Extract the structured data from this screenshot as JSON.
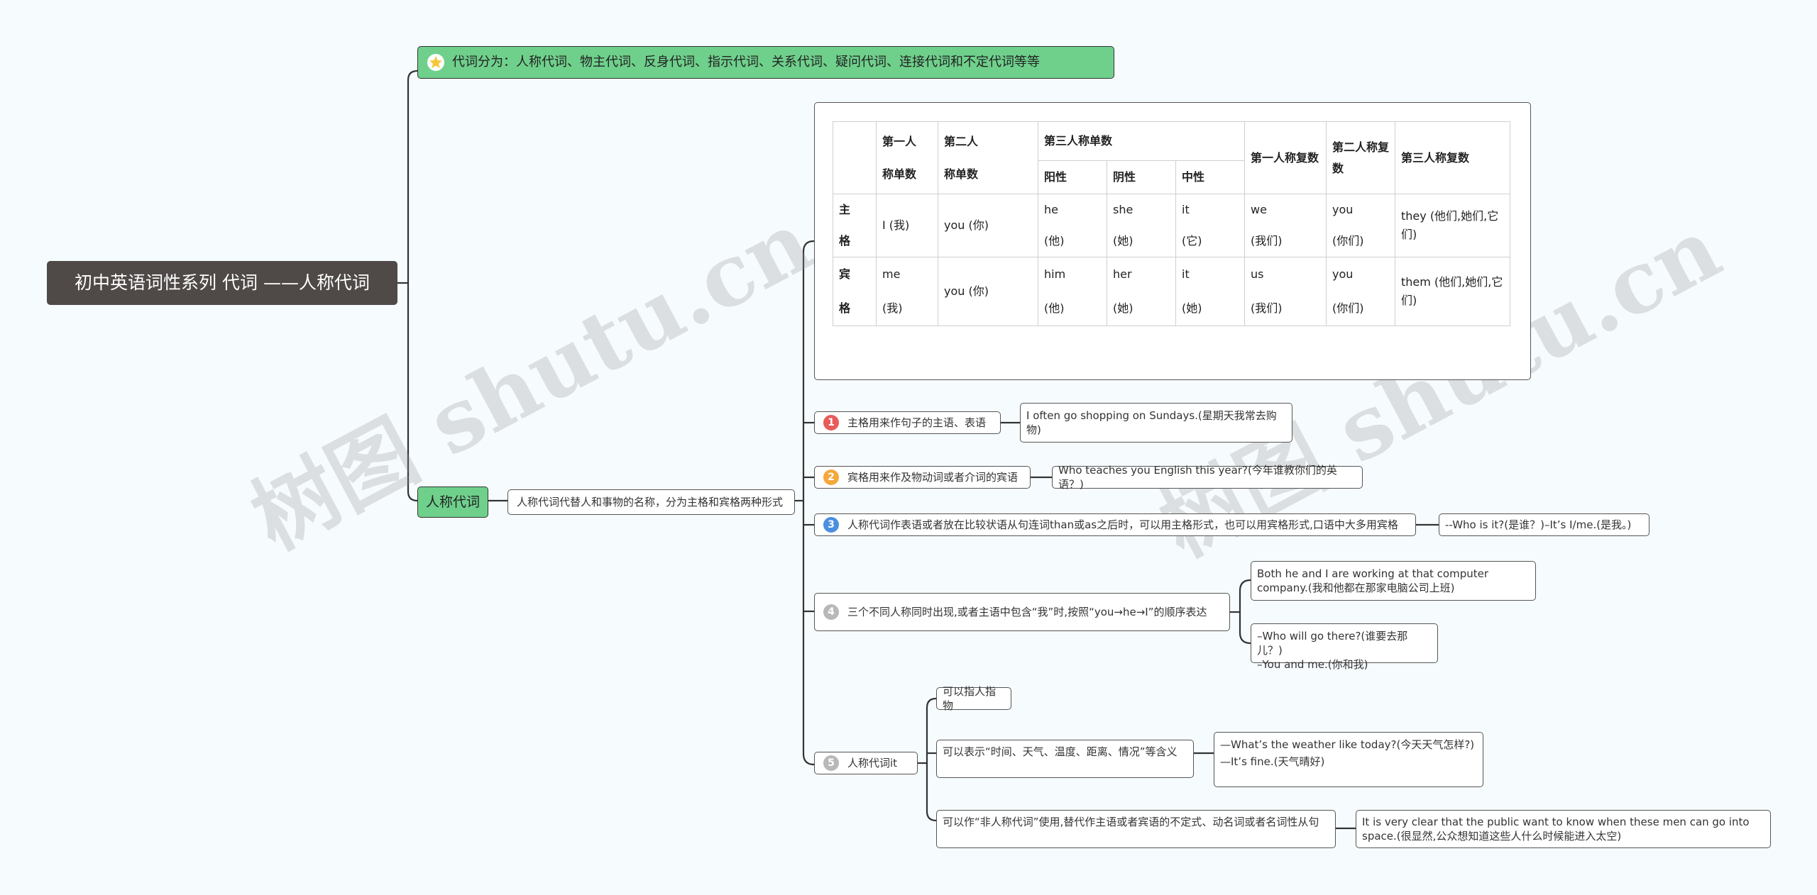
{
  "root": {
    "title": "初中英语词性系列 代词 ——人称代词"
  },
  "top_note": {
    "text": "代词分为：人称代词、物主代词、反身代词、指示代词、关系代词、疑问代词、连接代词和不定代词等等"
  },
  "branch": {
    "label": "人称代词",
    "desc": "人称代词代替人和事物的名称，分为主格和宾格两种形式"
  },
  "table": {
    "h_first_single_a": "第一人",
    "h_first_single_b": "称单数",
    "h_second_single_a": "第二人",
    "h_second_single_b": "称单数",
    "h_third_single": "第三人称单数",
    "h_masc": "阳性",
    "h_fem": "阴性",
    "h_neut": "中性",
    "h_first_plural": "第一人称复数",
    "h_second_plural": "第二人称复数",
    "h_third_plural": "第三人称复数",
    "row1_label_a": "主",
    "row1_label_b": "格",
    "row1": {
      "c1": "I (我)",
      "c2": "you (你)",
      "c3a": "he",
      "c3b": "(他)",
      "c4a": "she",
      "c4b": "(她)",
      "c5a": "it",
      "c5b": "(它)",
      "c6a": "we",
      "c6b": "(我们)",
      "c7a": "you",
      "c7b": "(你们)",
      "c8": "they (他们,她们,它们)"
    },
    "row2_label_a": "宾",
    "row2_label_b": "格",
    "row2": {
      "c1a": "me",
      "c1b": "(我)",
      "c2": "you (你)",
      "c3a": "him",
      "c3b": "(他)",
      "c4a": "her",
      "c4b": "(她)",
      "c5a": "it",
      "c5b": "(她)",
      "c6a": "us",
      "c6b": "(我们)",
      "c7a": "you",
      "c7b": "(你们)",
      "c8": "them (他们,她们,它们)"
    }
  },
  "rules": [
    {
      "num": "1",
      "color": "#e95a5a",
      "text": "主格用来作句子的主语、表语",
      "example": "I often go shopping on Sundays.(星期天我常去购物)"
    },
    {
      "num": "2",
      "color": "#f4a83c",
      "text": "宾格用来作及物动词或者介词的宾语",
      "example": "Who teaches you English this year?(今年谁教你们的英语？)"
    },
    {
      "num": "3",
      "color": "#4a8fe0",
      "text": "人称代词作表语或者放在比较状语从句连词than或as之后时，可以用主格形式，也可以用宾格形式,口语中大多用宾格",
      "example": "--Who is it?(是谁？)–It’s I/me.(是我。)"
    },
    {
      "num": "4",
      "color": "#b8b8b8",
      "text": "三个不同人称同时出现,或者主语中包含“我”时,按照“you→he→I”的顺序表达",
      "example_a": "Both he and I are working at that computer company.(我和他都在那家电脑公司上班)",
      "example_b_1": "–Who will go there?(谁要去那儿？)",
      "example_b_2": "–You and me.(你和我)"
    },
    {
      "num": "5",
      "color": "#b8b8b8",
      "text": "人称代词it"
    }
  ],
  "it_uses": {
    "a": "可以指人指物",
    "b": "可以表示“时间、天气、温度、距离、情况”等含义",
    "b_ex_1": "—What’s the weather like today?(今天天气怎样?)",
    "b_ex_2": "—It’s fine.(天气晴好)",
    "c": "可以作“非人称代词”使用,替代作主语或者宾语的不定式、动名词或者名词性从句",
    "c_ex": "It is very clear that the public want to know when these men can go into space.(很显然,公众想知道这些人什么时候能进入太空)"
  },
  "watermarks": {
    "w1": "树图 shutu.cn",
    "w2": "树图 shutu.cn"
  },
  "colors": {
    "background": "#f6fbfe",
    "root": "#4f4a47",
    "green": "#6fd08c",
    "line": "#333333"
  }
}
